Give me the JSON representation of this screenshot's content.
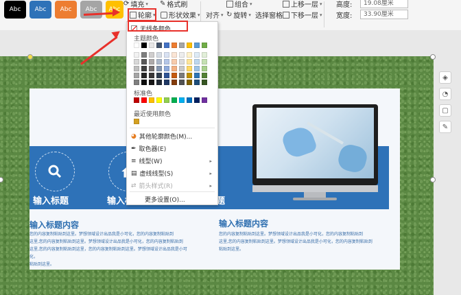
{
  "ribbon": {
    "style_swatches": [
      {
        "label": "Abc",
        "bg": "#000000",
        "fg": "#ffffff"
      },
      {
        "label": "Abc",
        "bg": "#2e72b8",
        "fg": "#ffffff"
      },
      {
        "label": "Abc",
        "bg": "#ed7d31",
        "fg": "#ffffff"
      },
      {
        "label": "Abc",
        "bg": "#a5a5a5",
        "fg": "#ffffff"
      },
      {
        "label": "Abc",
        "bg": "#ffc000",
        "fg": "#ffffff"
      }
    ],
    "fill_label": "填充",
    "format_painter_label": "格式刷",
    "outline_label": "轮廓",
    "shape_effect_label": "形状效果",
    "align_label": "对齐",
    "group_label": "组合",
    "rotate_label": "旋转",
    "selection_pane_label": "选择窗格",
    "bring_forward_label": "上移一层",
    "send_backward_label": "下移一层",
    "height_label": "高度:",
    "height_value": "19.08厘米",
    "width_label": "宽度:",
    "width_value": "33.90厘米"
  },
  "slide": {
    "heading_left_1": "输入标题",
    "heading_left_2": "输入标",
    "heading_right_fragment": "题",
    "content_title_left": "输入标题内容",
    "content_title_right": "输入标题内容",
    "body_lines_left": [
      "您的内容复制粘贴到这里。梦想领域设计出品我是小可化，您的内容复制粘贴到",
      "这里,您的内容复制粘贴到这里。梦想领域设计出品我是小可化，您的内容复制粘贴到",
      "这里,您的内容复制粘贴到这里，您的内容复制粘贴到这里。梦想领域设计出品我是小可化，",
      "粘贴到这里。"
    ],
    "body_lines_right": [
      "您的内容复制粘贴到这里。梦想领域设计出品我是小可化，您的内容复制粘贴到",
      "这里,您的内容复制粘贴到这里。梦想领域设计出品我是小可化，您的内容复制粘贴到",
      "粘贴到这里。"
    ]
  },
  "dropdown": {
    "no_outline_label": "无线条颜色",
    "theme_colors_label": "主题颜色",
    "standard_colors_label": "标准色",
    "recent_colors_label": "最近使用颜色",
    "more_colors_label": "其他轮廓颜色(M)...",
    "eyedropper_label": "取色器(E)",
    "line_type_label": "线型(W)",
    "dash_type_label": "虚线线型(S)",
    "arrow_style_label": "箭头样式(R)",
    "more_settings_label": "更多设置(O)...",
    "theme_top_row": [
      "#ffffff",
      "#000000",
      "#e7e6e6",
      "#44546a",
      "#4472c4",
      "#ed7d31",
      "#a5a5a5",
      "#ffc000",
      "#5b9bd5",
      "#70ad47"
    ],
    "theme_shades": [
      [
        "#f2f2f2",
        "#7f7f7f",
        "#d0cece",
        "#d6dce4",
        "#d9e2f3",
        "#fbe5d5",
        "#ededed",
        "#fff2cc",
        "#deebf6",
        "#e2efd9"
      ],
      [
        "#d8d8d8",
        "#595959",
        "#aeaaaa",
        "#adb9ca",
        "#b4c6e7",
        "#f7cbac",
        "#dbdbdb",
        "#fee599",
        "#bdd7ee",
        "#c5e0b3"
      ],
      [
        "#bfbfbf",
        "#3f3f3f",
        "#757070",
        "#8496b0",
        "#8eaadb",
        "#f4b183",
        "#c9c9c9",
        "#ffd965",
        "#9dc3e6",
        "#a8d08d"
      ],
      [
        "#a5a5a5",
        "#262626",
        "#3a3838",
        "#323f4f",
        "#2f5496",
        "#c55a11",
        "#7b7b7b",
        "#bf9000",
        "#2e75b5",
        "#538135"
      ],
      [
        "#7f7f7f",
        "#0c0c0c",
        "#171616",
        "#222a35",
        "#1f3864",
        "#833c0b",
        "#525252",
        "#7f6000",
        "#1e4e79",
        "#375623"
      ]
    ],
    "standard_colors": [
      "#c00000",
      "#ff0000",
      "#ffc000",
      "#ffff00",
      "#92d050",
      "#00b050",
      "#00b0f0",
      "#0070c0",
      "#002060",
      "#7030a0"
    ],
    "recent_colors": [
      "#d4a020"
    ]
  },
  "side_tools": [
    "layers-icon",
    "shape-icon",
    "frame-icon",
    "pen-icon"
  ]
}
